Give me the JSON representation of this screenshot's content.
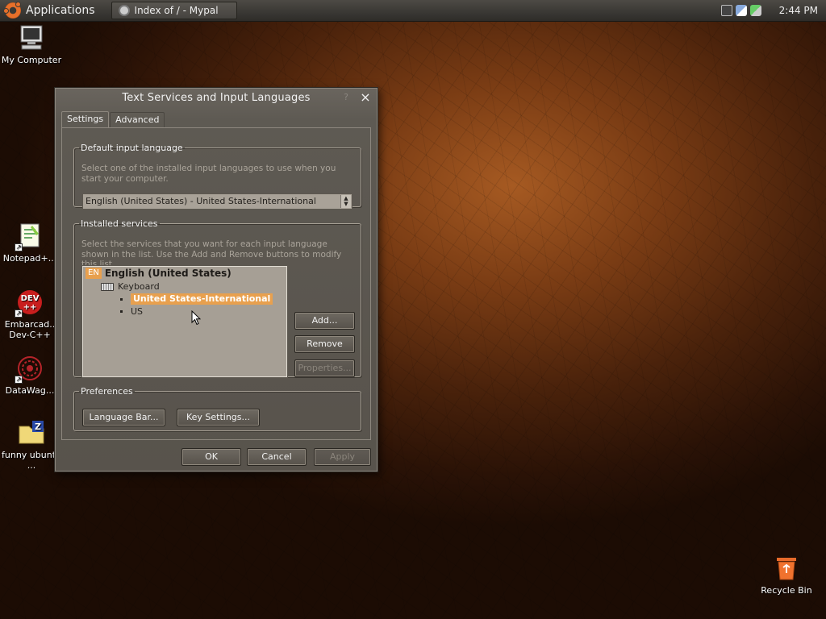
{
  "panel": {
    "applications_label": "Applications",
    "task_title": "Index of / - Mypal",
    "clock": "2:44 PM"
  },
  "desktop": {
    "icons": [
      {
        "label": "My Computer"
      },
      {
        "label": "Notepad+..."
      },
      {
        "label": "Embarcad.. Dev-C++"
      },
      {
        "label": "DataWag..."
      },
      {
        "label": "funny ubuntu ..."
      },
      {
        "label": "Recycle Bin"
      }
    ]
  },
  "dialog": {
    "title": "Text Services and Input Languages",
    "help_label": "?",
    "close_label": "×",
    "tabs": [
      {
        "label": "Settings",
        "selected": true
      },
      {
        "label": "Advanced",
        "selected": false
      }
    ],
    "default_language": {
      "legend": "Default input language",
      "description": "Select one of the installed input languages to use when you start your computer.",
      "selected": "English (United States) - United States-International"
    },
    "installed_services": {
      "legend": "Installed services",
      "description": "Select the services that you want for each input language shown in the list. Use the Add and Remove buttons to modify this list.",
      "language_badge": "EN",
      "language": "English (United States)",
      "category": "Keyboard",
      "layouts": [
        "United States-International",
        "US"
      ],
      "selected_layout": "United States-International"
    },
    "buttons": {
      "add": "Add...",
      "remove": "Remove",
      "properties": "Properties..."
    },
    "preferences": {
      "legend": "Preferences",
      "language_bar": "Language Bar...",
      "key_settings": "Key Settings..."
    },
    "footer": {
      "ok": "OK",
      "cancel": "Cancel",
      "apply": "Apply"
    }
  },
  "colors": {
    "highlight": "#e8a04e",
    "dialog_bg": "#5e5a53",
    "desktop_glow": "#a65a22"
  }
}
